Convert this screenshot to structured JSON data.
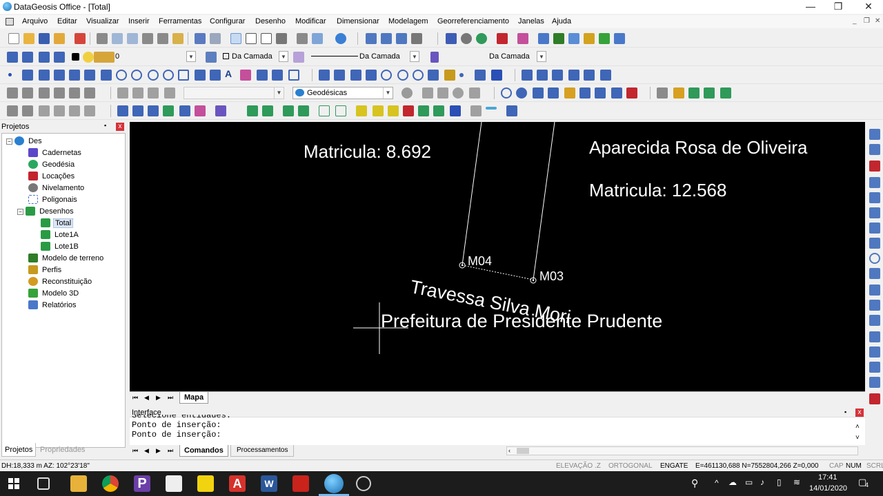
{
  "window": {
    "title": "DataGeosis Office - [Total]",
    "minimize": "—",
    "maximize": "❐",
    "close": "✕"
  },
  "menu": [
    "Arquivo",
    "Editar",
    "Visualizar",
    "Inserir",
    "Ferramentas",
    "Configurar",
    "Desenho",
    "Modificar",
    "Dimensionar",
    "Modelagem",
    "Georreferenciamento",
    "Janelas",
    "Ajuda"
  ],
  "menu_mdi": [
    "_",
    "❐",
    "✕"
  ],
  "toolbar": {
    "layer_value": "0",
    "linetype_mode": "Da Camada",
    "line_mode": "Da Camada",
    "weight_mode": "Da Camada",
    "coord_system": "Geodésicas"
  },
  "panel": {
    "title": "Projetos",
    "pin": "📌",
    "close": "x",
    "tabs": [
      "Projetos",
      "Propriedades"
    ]
  },
  "tree": [
    {
      "label": "Des",
      "icon": "globe-icon",
      "color": "#2a7fd0"
    },
    {
      "label": "Cadernetas",
      "icon": "grid-icon",
      "color": "#5b48c9"
    },
    {
      "label": "Geodésia",
      "icon": "globe-icon",
      "color": "#2aa85f"
    },
    {
      "label": "Locações",
      "icon": "survey-icon",
      "color": "#c2262e"
    },
    {
      "label": "Nivelamento",
      "icon": "level-icon",
      "color": "#777777"
    },
    {
      "label": "Poligonais",
      "icon": "polygon-icon",
      "color": "#4a6fc9"
    },
    {
      "label": "Desenhos",
      "icon": "drawing-icon",
      "color": "#2a9b45"
    },
    {
      "label": "Total",
      "icon": "drawing-icon",
      "color": "#2a9b45"
    },
    {
      "label": "Lote1A",
      "icon": "drawing-icon",
      "color": "#2a9b45"
    },
    {
      "label": "Lote1B",
      "icon": "drawing-icon",
      "color": "#2a9b45"
    },
    {
      "label": "Modelo de terreno",
      "icon": "terrain-icon",
      "color": "#2f7d28"
    },
    {
      "label": "Perfis",
      "icon": "profile-icon",
      "color": "#c79a1e"
    },
    {
      "label": "Reconstituição",
      "icon": "reconstruction-icon",
      "color": "#d39b20"
    },
    {
      "label": "Modelo 3D",
      "icon": "cube-icon",
      "color": "#36a23a"
    },
    {
      "label": "Relatórios",
      "icon": "report-icon",
      "color": "#4a78c9"
    }
  ],
  "map": {
    "labels": {
      "matricula_left": "Matricula: 8.692",
      "owner": "Aparecida Rosa de Oliveira",
      "matricula_right": "Matricula: 12.568",
      "m04": "M04",
      "m03": "M03",
      "street": "Travessa Silva Mori",
      "prefeitura": "Prefeitura de Presidente Prudente"
    },
    "tab": "Mapa"
  },
  "console": {
    "title": "Interface",
    "lines": [
      "Selecione entidades:",
      "Ponto de inserção:",
      "Ponto de inserção:"
    ],
    "tabs": [
      "Comandos",
      "Processamentos"
    ]
  },
  "status": {
    "left": "DH:18,333 m  AZ: 102°23'18\"",
    "elevacao": "ELEVAÇÃO .Z",
    "ortogonal": "ORTOGONAL",
    "engate": "ENGATE",
    "coords": "E=461130,688 N=7552804,266 Z=0,000",
    "cap": "CAP",
    "num": "NUM",
    "scrl": "SCRL"
  },
  "taskbar": {
    "time": "17:41",
    "date": "14/01/2020",
    "notif_count": "4"
  }
}
